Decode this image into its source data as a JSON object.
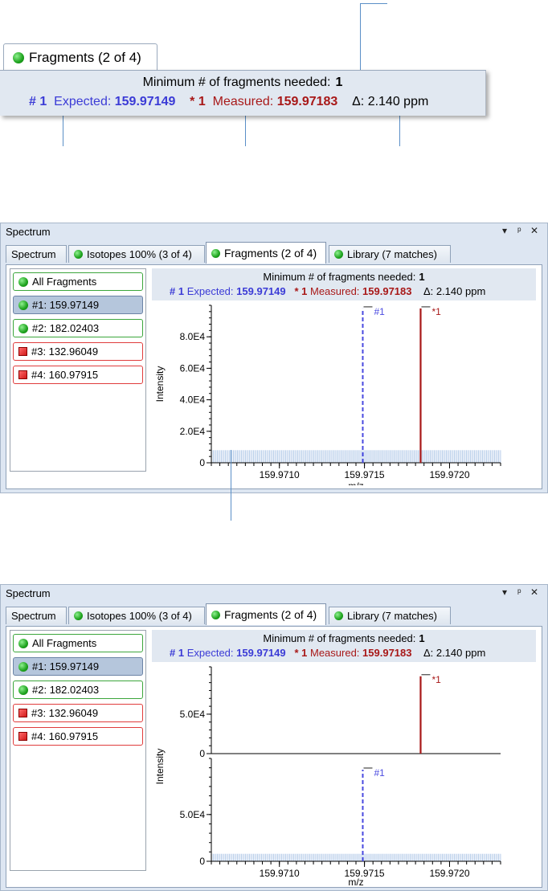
{
  "zoom": {
    "tab_label": "Fragments (2 of 4)",
    "min_label": "Minimum # of fragments needed:",
    "min_value": "1",
    "expected_id": "# 1",
    "expected_label": "Expected:",
    "expected_value": "159.97149",
    "measured_id": "* 1",
    "measured_label": "Measured:",
    "measured_value": "159.97183",
    "delta": "Δ: 2.140 ppm"
  },
  "panels": [
    {
      "title": "Spectrum",
      "controls": [
        "▾",
        "ᵖ",
        "✕"
      ],
      "tabs": [
        "Spectrum",
        "Isotopes 100% (3 of 4)",
        "Fragments (2 of 4)",
        "Library (7 matches)"
      ],
      "fragments": [
        {
          "label": "All Fragments",
          "kind": "green",
          "selected": false
        },
        {
          "label": "#1: 159.97149",
          "kind": "green",
          "selected": true
        },
        {
          "label": "#2: 182.02403",
          "kind": "green",
          "selected": false
        },
        {
          "label": "#3: 132.96049",
          "kind": "red",
          "selected": false
        },
        {
          "label": "#4: 160.97915",
          "kind": "red",
          "selected": false
        }
      ],
      "info": {
        "min_label": "Minimum # of fragments needed:",
        "min_value": "1",
        "expected_id": "# 1",
        "expected_label": "Expected:",
        "expected_value": "159.97149",
        "measured_id": "* 1",
        "measured_label": "Measured:",
        "measured_value": "159.97183",
        "delta": "Δ: 2.140 ppm"
      }
    },
    {
      "title": "Spectrum",
      "controls": [
        "▾",
        "ᵖ",
        "✕"
      ],
      "tabs": [
        "Spectrum",
        "Isotopes 100% (3 of 4)",
        "Fragments (2 of 4)",
        "Library (7 matches)"
      ],
      "fragments": [
        {
          "label": "All Fragments",
          "kind": "green",
          "selected": false
        },
        {
          "label": "#1: 159.97149",
          "kind": "green",
          "selected": true
        },
        {
          "label": "#2: 182.02403",
          "kind": "green",
          "selected": false
        },
        {
          "label": "#3: 132.96049",
          "kind": "red",
          "selected": false
        },
        {
          "label": "#4: 160.97915",
          "kind": "red",
          "selected": false
        }
      ],
      "info": {
        "min_label": "Minimum # of fragments needed:",
        "min_value": "1",
        "expected_id": "# 1",
        "expected_label": "Expected:",
        "expected_value": "159.97149",
        "measured_id": "* 1",
        "measured_label": "Measured:",
        "measured_value": "159.97183",
        "delta": "Δ: 2.140 ppm"
      }
    }
  ],
  "chart_data": [
    {
      "type": "line",
      "xlabel": "m/z",
      "ylabel": "Intensity",
      "xlim": [
        159.9706,
        159.9723
      ],
      "ylim": [
        0,
        100000
      ],
      "x_ticks": [
        159.971,
        159.9715,
        159.972
      ],
      "x_tick_labels": [
        "159.9710",
        "159.9715",
        "159.9720"
      ],
      "y_ticks": [
        0,
        20000,
        40000,
        60000,
        80000
      ],
      "y_tick_labels": [
        "0",
        "2.0E4",
        "4.0E4",
        "6.0E4",
        "8.0E4"
      ],
      "series": [
        {
          "name": "#1",
          "x": [
            159.97149
          ],
          "y": [
            98000
          ],
          "color": "#4a4ae0",
          "style": "dashed"
        },
        {
          "name": "*1",
          "x": [
            159.97183
          ],
          "y": [
            98000
          ],
          "color": "#a81818",
          "style": "solid"
        }
      ],
      "noise_level": 8000,
      "noise_color": "#aac4e6"
    },
    {
      "type": "line",
      "layout": "mirror",
      "xlabel": "m/z",
      "ylabel": "Intensity",
      "xlim": [
        159.9706,
        159.9723
      ],
      "top": {
        "ylim": [
          0,
          110000
        ],
        "y_ticks": [
          0,
          50000
        ],
        "y_tick_labels": [
          "0",
          "5.0E4"
        ],
        "series": [
          {
            "name": "*1",
            "x": [
              159.97183
            ],
            "y": [
              98000
            ],
            "color": "#a81818",
            "style": "solid"
          }
        ]
      },
      "bottom": {
        "ylim": [
          0,
          110000
        ],
        "y_ticks": [
          0,
          50000
        ],
        "y_tick_labels": [
          "0",
          "5.0E4"
        ],
        "series": [
          {
            "name": "#1",
            "x": [
              159.97149
            ],
            "y": [
              98000
            ],
            "color": "#4a4ae0",
            "style": "dashed"
          }
        ],
        "noise_level": 8000
      },
      "x_ticks": [
        159.971,
        159.9715,
        159.972
      ],
      "x_tick_labels": [
        "159.9710",
        "159.9715",
        "159.9720"
      ]
    }
  ]
}
